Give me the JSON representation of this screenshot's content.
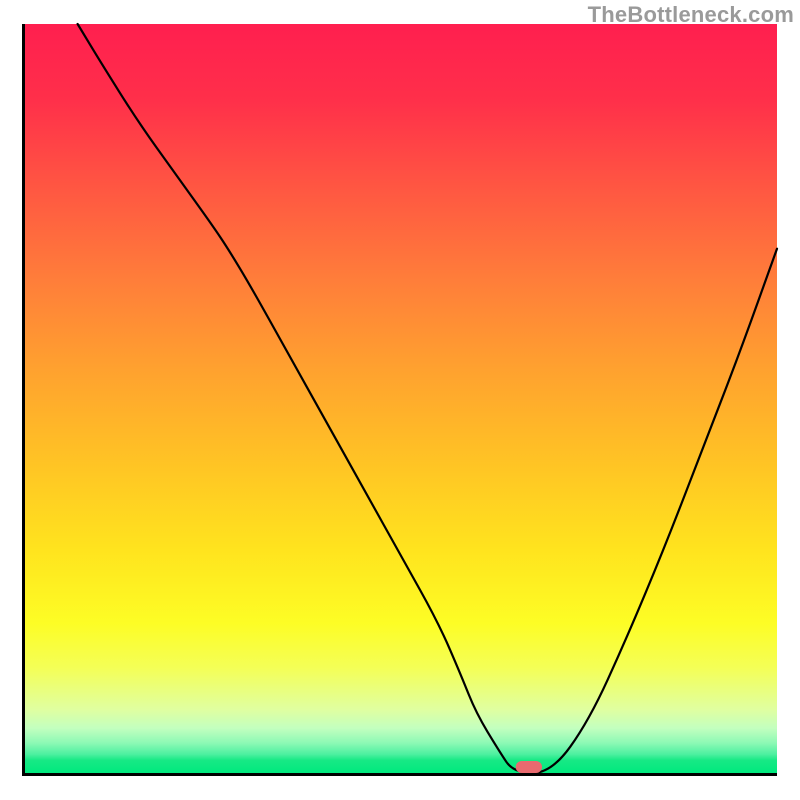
{
  "watermark": "TheBottleneck.com",
  "colors": {
    "gradient_top": "#ff1f4f",
    "gradient_mid1": "#ff7d3a",
    "gradient_mid2": "#ffe31e",
    "gradient_bottom_band": "#00e97e",
    "axis": "#000000",
    "curve": "#000000",
    "marker": "#e96a6f"
  },
  "chart_data": {
    "type": "line",
    "title": "",
    "xlabel": "",
    "ylabel": "",
    "xlim": [
      0,
      100
    ],
    "ylim": [
      0,
      100
    ],
    "grid": false,
    "legend": false,
    "x": [
      7,
      10,
      15,
      20,
      25,
      27,
      30,
      35,
      40,
      45,
      50,
      55,
      58,
      60,
      63,
      65,
      70,
      75,
      80,
      85,
      90,
      95,
      100
    ],
    "values": [
      100,
      95,
      87,
      80,
      73,
      70,
      65,
      56,
      47,
      38,
      29,
      20,
      13,
      8,
      3,
      0,
      0,
      7,
      18,
      30,
      43,
      56,
      70
    ],
    "marker": {
      "x": 67,
      "y": 0.8,
      "width": 3.5,
      "height": 1.6
    },
    "notes": "y is percent of plot height from bottom (0 = bottom axis, 100 = top). x is percent of plot width from left axis."
  }
}
